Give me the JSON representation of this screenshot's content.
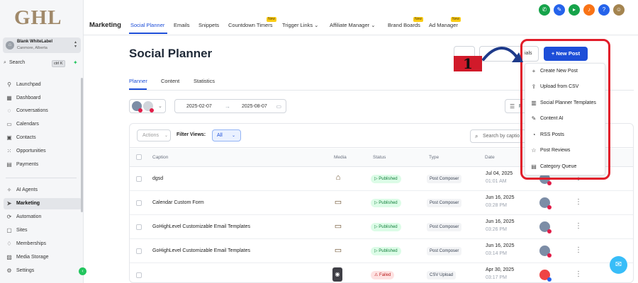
{
  "sidebar": {
    "logo": "GHL",
    "account": {
      "name": "Blank WhiteLabel",
      "location": "Canmore, Alberta"
    },
    "search": {
      "label": "Search",
      "shortcut": "ctrl K"
    },
    "items": [
      {
        "label": "Launchpad",
        "icon": "rocket-icon"
      },
      {
        "label": "Dashboard",
        "icon": "grid-icon"
      },
      {
        "label": "Conversations",
        "icon": "chat-icon"
      },
      {
        "label": "Calendars",
        "icon": "calendar-icon"
      },
      {
        "label": "Contacts",
        "icon": "contact-card-icon"
      },
      {
        "label": "Opportunities",
        "icon": "pipeline-icon"
      },
      {
        "label": "Payments",
        "icon": "receipt-icon"
      },
      {
        "label": "AI Agents",
        "icon": "sparkle-icon"
      },
      {
        "label": "Marketing",
        "icon": "send-icon"
      },
      {
        "label": "Automation",
        "icon": "gear-cycle-icon"
      },
      {
        "label": "Sites",
        "icon": "sites-icon"
      },
      {
        "label": "Memberships",
        "icon": "graduation-icon"
      },
      {
        "label": "Media Storage",
        "icon": "image-icon"
      },
      {
        "label": "Settings",
        "icon": "gear-icon"
      }
    ]
  },
  "topbar": {
    "module": "Marketing",
    "badge": "New",
    "tabs": [
      {
        "label": "Social Planner"
      },
      {
        "label": "Emails"
      },
      {
        "label": "Snippets"
      },
      {
        "label": "Countdown Timers"
      },
      {
        "label": "Trigger Links"
      },
      {
        "label": "Affiliate Manager"
      },
      {
        "label": "Brand Boards"
      },
      {
        "label": "Ad Manager"
      }
    ],
    "icons": [
      "phone-icon",
      "megaphone-icon",
      "announcement-icon",
      "bell-icon",
      "help-icon"
    ]
  },
  "page": {
    "title": "Social Planner",
    "header_partial": "ials",
    "new_post_label": "New Post",
    "sub_tabs": [
      "Planner",
      "Content",
      "Statistics"
    ],
    "date_start": "2025-02-07",
    "date_end": "2025-08-07",
    "filter_label": "F"
  },
  "table": {
    "actions_label": "Actions",
    "filter_views_label": "Filter Views:",
    "filter_views_value": "All",
    "search_placeholder": "Search by captio",
    "headers": {
      "caption": "Caption",
      "media": "Media",
      "status": "Status",
      "type": "Type",
      "date": "Date"
    },
    "rows": [
      {
        "caption": "dgsd",
        "status": "Published",
        "type": "Post Composer",
        "date": "Jul 04, 2025",
        "time": "01:01 AM"
      },
      {
        "caption": "Calendar Custom Form",
        "status": "Published",
        "type": "Post Composer",
        "date": "Jun 16, 2025",
        "time": "03:28 PM"
      },
      {
        "caption": "GoHighLevel Customizable Email Templates",
        "status": "Published",
        "type": "Post Composer",
        "date": "Jun 16, 2025",
        "time": "03:26 PM"
      },
      {
        "caption": "GoHighLevel Customizable Email Templates",
        "status": "Published",
        "type": "Post Composer",
        "date": "Jun 16, 2025",
        "time": "03:14 PM"
      },
      {
        "caption": "",
        "status": "Failed",
        "type": "CSV Upload",
        "date": "Apr 30, 2025",
        "time": "03:17 PM"
      }
    ]
  },
  "menu": {
    "items": [
      {
        "label": "Create New Post",
        "icon": "plus-icon"
      },
      {
        "label": "Upload from CSV",
        "icon": "upload-icon"
      },
      {
        "label": "Social Planner Templates",
        "icon": "template-icon"
      },
      {
        "label": "Content AI",
        "icon": "magic-wand-icon"
      },
      {
        "label": "RSS Posts",
        "icon": "rss-icon"
      },
      {
        "label": "Post Reviews",
        "icon": "star-icon"
      },
      {
        "label": "Category Queue",
        "icon": "queue-icon"
      }
    ]
  },
  "annotation": {
    "step": "1"
  },
  "colors": {
    "primary": "#1d4ed8",
    "highlight": "#e11d2a",
    "brand": "#a0896a",
    "published": "#15803d",
    "failed": "#b91c1c"
  }
}
